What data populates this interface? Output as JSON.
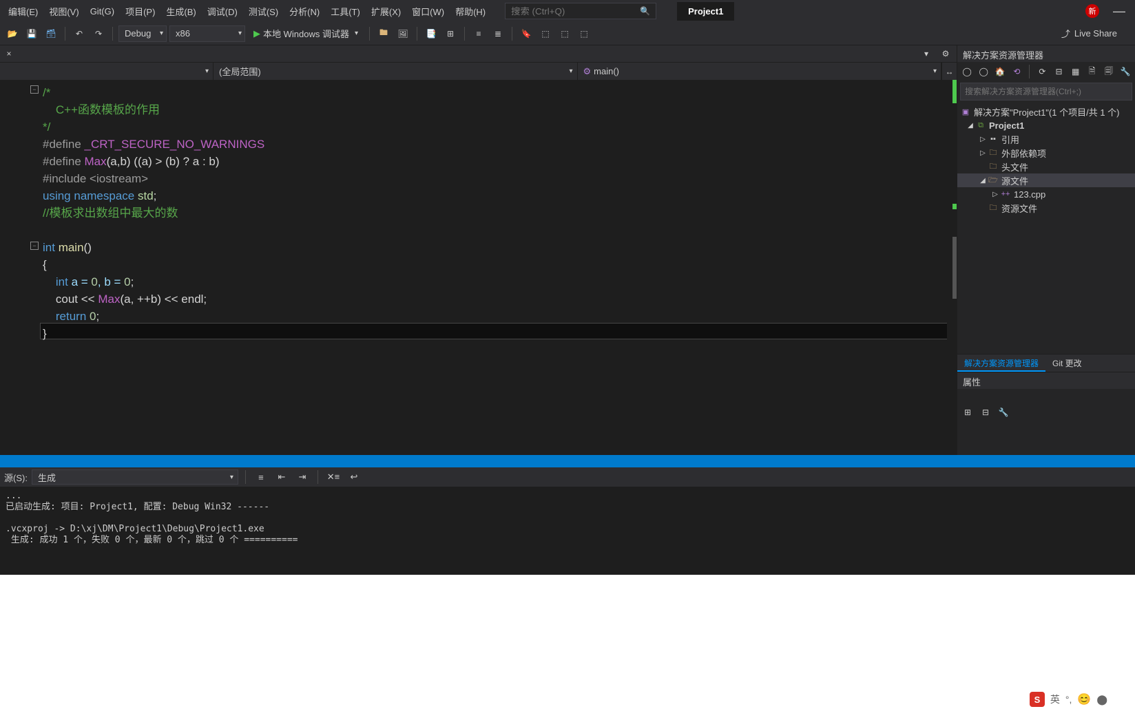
{
  "menubar": {
    "items": [
      "编辑(E)",
      "视图(V)",
      "Git(G)",
      "项目(P)",
      "生成(B)",
      "调试(D)",
      "测试(S)",
      "分析(N)",
      "工具(T)",
      "扩展(X)",
      "窗口(W)",
      "帮助(H)"
    ],
    "search_placeholder": "搜索 (Ctrl+Q)",
    "project_name": "Project1",
    "new_badge": "新"
  },
  "toolbar": {
    "config": "Debug",
    "platform": "x86",
    "run_label": "本地 Windows 调试器",
    "liveshare": "Live Share"
  },
  "nav": {
    "scope": "(全局范围)",
    "func_icon": "⚙",
    "func": "main()"
  },
  "code": {
    "l1": "/*",
    "l2": "    C++函数模板的作用",
    "l3": "*/",
    "l4a": "#define",
    "l4b": " _CRT_SECURE_NO_WARNINGS",
    "l5a": "#define",
    "l5b": " Max",
    "l5c": "(a,b) ((a) > (b) ? a : b)",
    "l6a": "#include",
    "l6b": " <iostream>",
    "l7a": "using",
    "l7b": " namespace",
    "l7c": " std",
    "l7d": ";",
    "l8": "//模板求出数组中最大的数",
    "l9a": "int",
    "l9b": " main",
    "l9c": "()",
    "l10": "{",
    "l11a": "    int",
    "l11b": " a = ",
    "l11c": "0",
    "l11d": ", b = ",
    "l11e": "0",
    "l11f": ";",
    "l12a": "    cout << ",
    "l12b": "Max",
    "l12c": "(a, ++b) << endl;",
    "l13a": "    return",
    "l13b": " 0",
    "l13c": ";",
    "l14": "}"
  },
  "solution": {
    "panel_title": "解决方案资源管理器",
    "search_placeholder": "搜索解决方案资源管理器(Ctrl+;)",
    "root": "解决方案\"Project1\"(1 个项目/共 1 个)",
    "project": "Project1",
    "refs": "引用",
    "external": "外部依赖项",
    "headers": "头文件",
    "sources": "源文件",
    "file1": "123.cpp",
    "resources": "资源文件",
    "tab1": "解决方案资源管理器",
    "tab2": "Git 更改"
  },
  "properties": {
    "title": "属性"
  },
  "output": {
    "label_prefix": "源(S):",
    "source": "生成",
    "text": "...\n已启动生成: 项目: Project1, 配置: Debug Win32 ------\n\n.vcxproj -> D:\\xj\\DM\\Project1\\Debug\\Project1.exe\n 生成: 成功 1 个，失败 0 个，最新 0 个，跳过 0 个 =========="
  },
  "ime": {
    "logo": "S",
    "lang": "英"
  }
}
